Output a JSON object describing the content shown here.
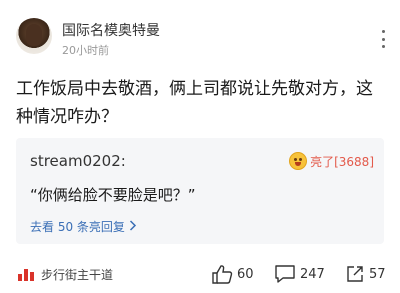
{
  "post": {
    "author": "国际名模奥特曼",
    "time": "20小时前",
    "question": "工作饭局中去敬酒，俩上司都说让先敬对方，这种情况咋办？"
  },
  "reply": {
    "user": "stream0202:",
    "light_label": "亮了[3688]",
    "quote": "“你俩给脸不要脸是吧？”",
    "more_replies": "去看 50 条亮回复",
    "more_replies_icon": "chevron-right-icon"
  },
  "footer": {
    "column": "步行街主干道",
    "likes": "60",
    "comments": "247",
    "shares": "57"
  },
  "colors": {
    "accent_red": "#e35a4b",
    "link_blue": "#3b6fb6",
    "card_bg": "#f5f6f8"
  }
}
